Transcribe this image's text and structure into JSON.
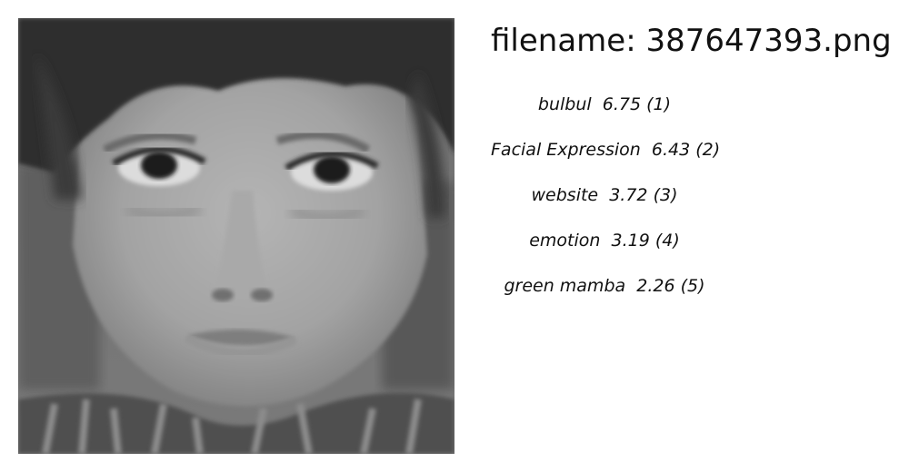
{
  "filename_line": "filename: 387647393.png",
  "image": {
    "subject": "grayscale close-up photo of a young boy's face"
  },
  "predictions": [
    {
      "label": "bulbul",
      "score": "6.75",
      "rank": "(1)"
    },
    {
      "label": "Facial Expression",
      "score": "6.43",
      "rank": "(2)"
    },
    {
      "label": "website",
      "score": "3.72",
      "rank": "(3)"
    },
    {
      "label": "emotion",
      "score": "3.19",
      "rank": "(4)"
    },
    {
      "label": "green mamba",
      "score": "2.26",
      "rank": "(5)"
    }
  ]
}
